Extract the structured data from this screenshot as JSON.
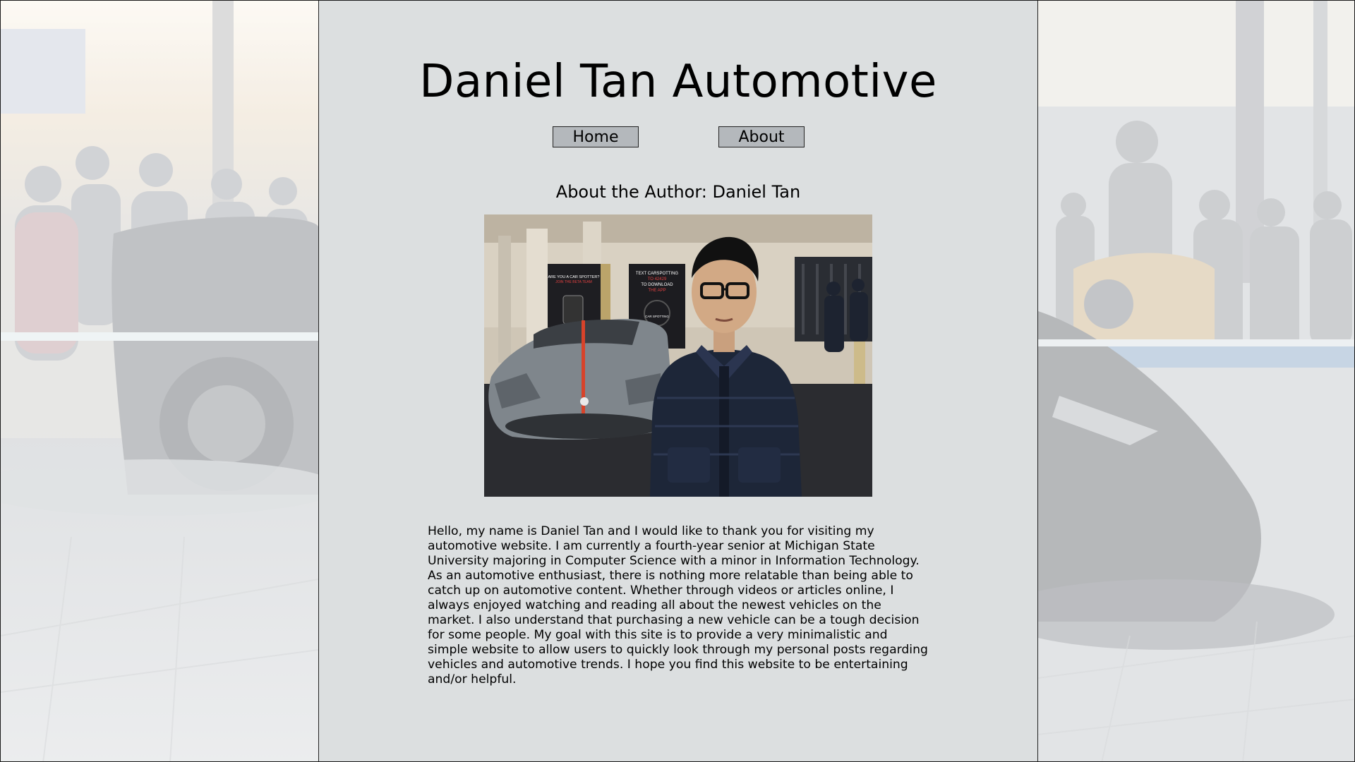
{
  "site": {
    "title": "Daniel Tan Automotive"
  },
  "nav": {
    "home_label": "Home",
    "about_label": "About"
  },
  "about": {
    "heading": "About the Author: Daniel Tan",
    "bio": "Hello, my name is Daniel Tan and I would like to thank you for visiting my automotive website. I am currently a fourth-year senior at Michigan State University majoring in Computer Science with a minor in Information Technology. As an automotive enthusiast, there is nothing more relatable than being able to catch up on automotive content. Whether through videos or articles online, I always enjoyed watching and reading all about the newest vehicles on the market. I also understand that purchasing a new vehicle can be a tough decision for some people. My goal with this site is to provide a very minimalistic and simple website to allow users to quickly look through my personal posts regarding vehicles and automotive trends. I hope you find this website to be entertaining and/or helpful."
  },
  "photo": {
    "sign_1": "ARE YOU A CAR SPOTTER?",
    "sign_1b": "JOIN THE BETA TEAM",
    "sign_2": "TEXT CARSPOTTING",
    "sign_2b": "TO 42429",
    "sign_2c": "TO DOWNLOAD",
    "sign_2d": "THE APP",
    "sign_2e": "CAR SPOTTING"
  },
  "colors": {
    "panel_bg": "#dcdfe0",
    "button_bg": "#b4b8bc",
    "border": "#222222"
  }
}
